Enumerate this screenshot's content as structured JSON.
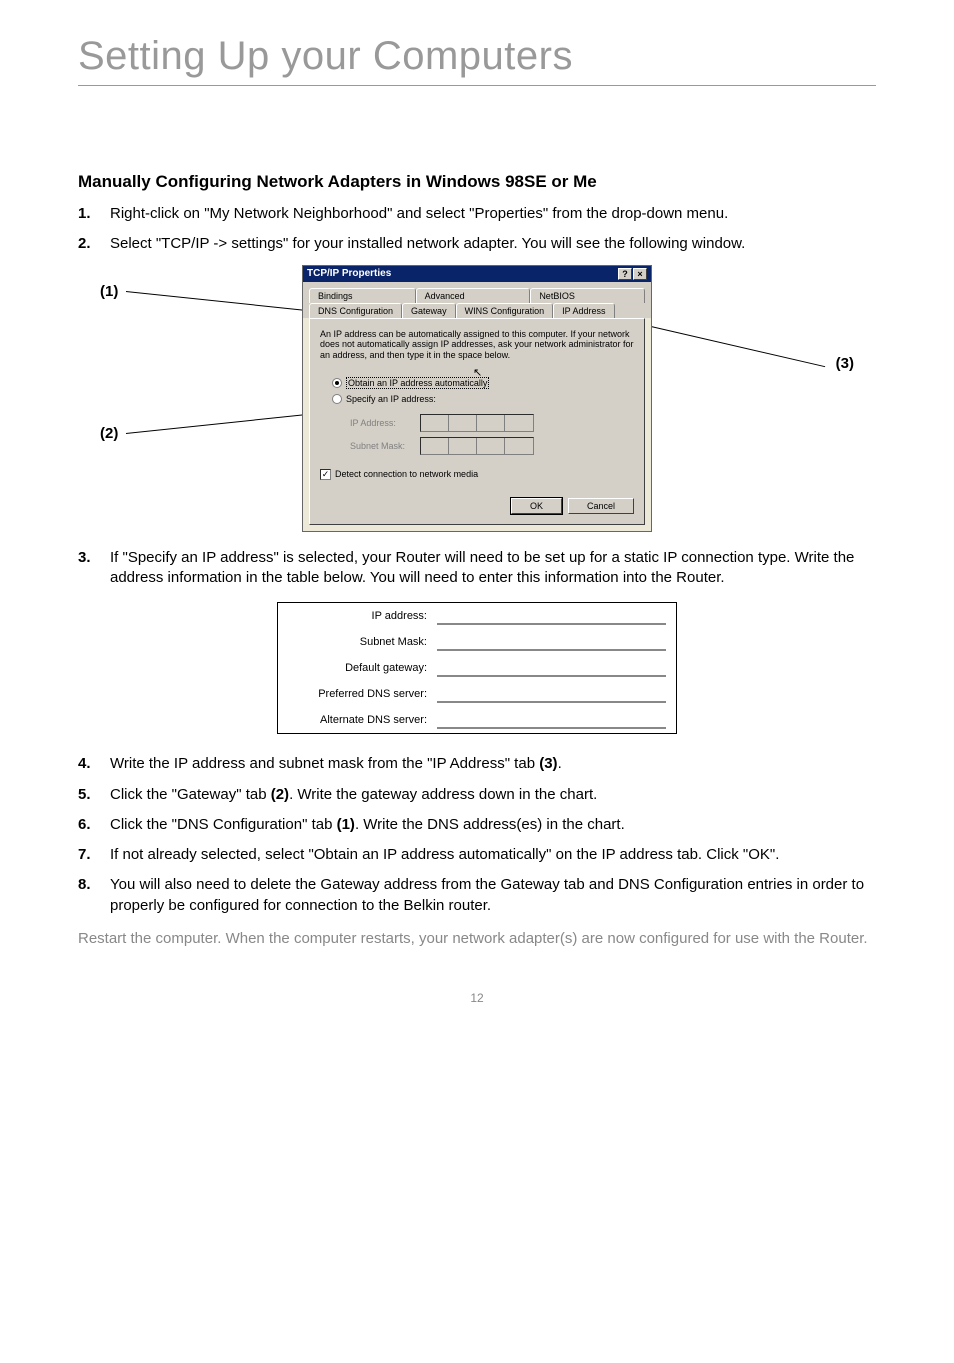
{
  "page_title": "Setting Up your Computers",
  "section_title": "Manually Configuring Network Adapters in Windows 98SE or Me",
  "step1": {
    "num": "1.",
    "text": "Right-click on \"My Network Neighborhood\" and select \"Properties\" from the drop-down menu."
  },
  "step2": {
    "num": "2.",
    "text": "Select \"TCP/IP -> settings\" for your installed network adapter. You will see the following window."
  },
  "dialog": {
    "title": "TCP/IP Properties",
    "help_btn": "?",
    "close_btn": "×",
    "tabs_row1": {
      "t1": "Bindings",
      "t2": "Advanced",
      "t3": "NetBIOS"
    },
    "tabs_row2": {
      "t1": "DNS Configuration",
      "t2": "Gateway",
      "t3": "WINS Configuration",
      "t4": "IP Address"
    },
    "desc": "An IP address can be automatically assigned to this computer. If your network does not automatically assign IP addresses, ask your network administrator for an address, and then type it in the space below.",
    "radio1": "Obtain an IP address automatically",
    "radio2": "Specify an IP address:",
    "ip_label": "IP Address:",
    "mask_label": "Subnet Mask:",
    "checkbox": "Detect connection to network media",
    "ok": "OK",
    "cancel": "Cancel"
  },
  "callouts": {
    "c1": "(1)",
    "c2": "(2)",
    "c3": "(3)"
  },
  "step3": {
    "num": "3.",
    "text": "If \"Specify an IP address\" is selected, your Router will need to be set up for a static IP connection type. Write the address information in the table below. You will need to enter this information into the Router."
  },
  "info_table": {
    "r1": "IP address:",
    "r2": "Subnet Mask:",
    "r3": "Default gateway:",
    "r4": "Preferred DNS server:",
    "r5": "Alternate DNS server:"
  },
  "step4": {
    "num": "4.",
    "text_a": "Write the IP address and subnet mask from the \"IP Address\" tab ",
    "text_b": "(3)",
    "text_c": "."
  },
  "step5": {
    "num": "5.",
    "text_a": "Click the \"Gateway\" tab ",
    "text_b": "(2)",
    "text_c": ". Write the gateway address down in the chart."
  },
  "step6": {
    "num": "6.",
    "text_a": "Click the \"DNS Configuration\" tab ",
    "text_b": "(1)",
    "text_c": ". Write the DNS address(es) in the chart."
  },
  "step7": {
    "num": "7.",
    "text": "If not already selected, select \"Obtain an IP address automatically\" on the IP address tab. Click \"OK\"."
  },
  "step8": {
    "num": "8.",
    "text": "You will also need to delete the Gateway address from the Gateway tab and DNS Configuration entries in order to properly be configured for connection to the Belkin router."
  },
  "restart": "Restart the computer. When the computer restarts, your network adapter(s) are now configured for use with the Router.",
  "page_number": "12"
}
